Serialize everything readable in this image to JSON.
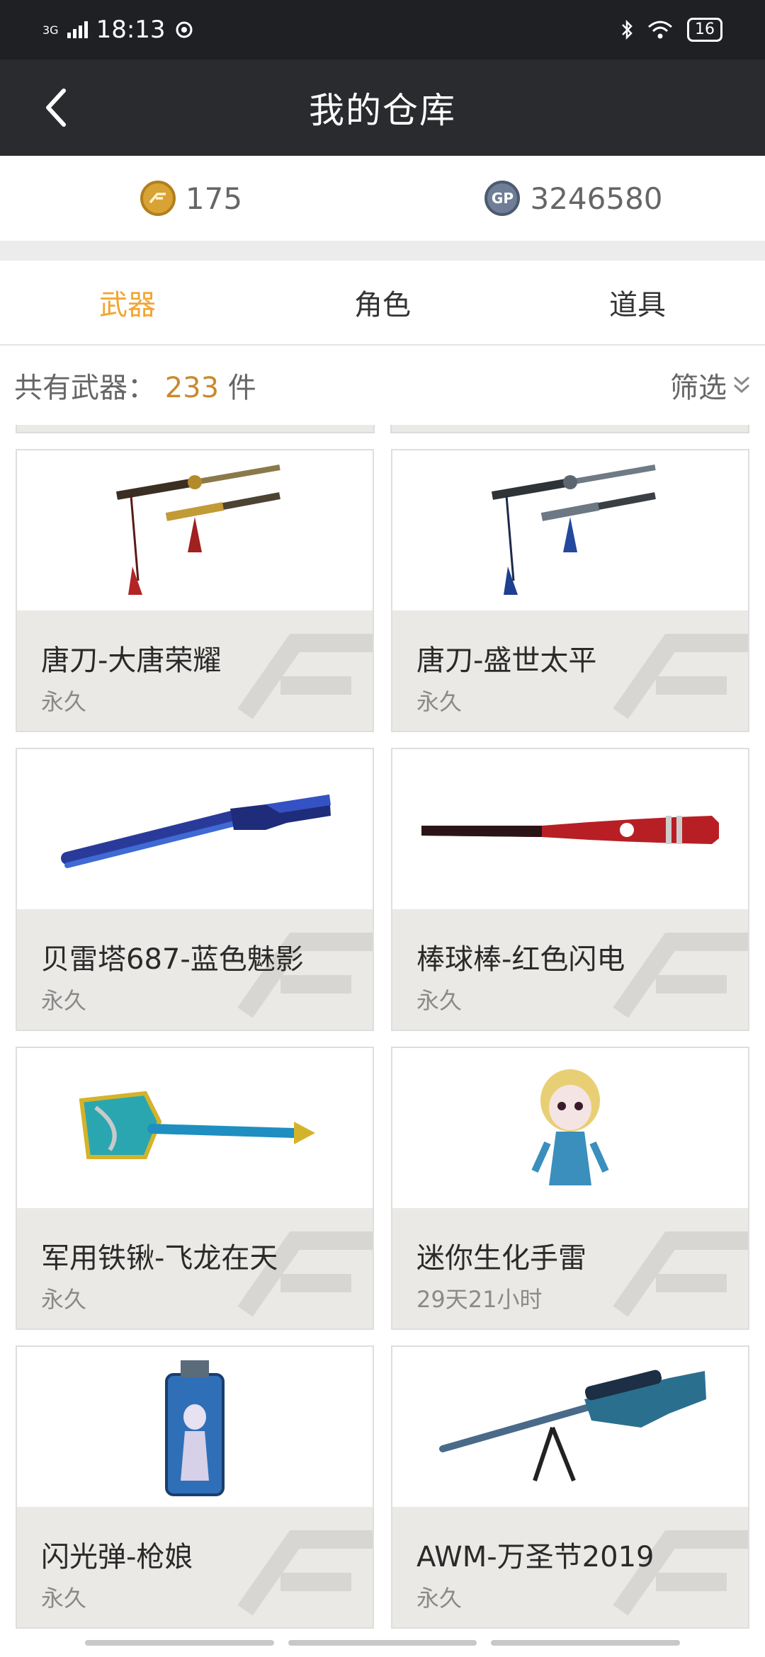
{
  "status_bar": {
    "time": "18:13",
    "network": "3G",
    "battery": "16"
  },
  "header": {
    "title": "我的仓库"
  },
  "currency": {
    "cf": {
      "icon": "cf-coin-icon",
      "value": "175"
    },
    "gp": {
      "icon": "gp-coin-icon",
      "label": "GP",
      "value": "3246580"
    }
  },
  "tabs": [
    {
      "label": "武器",
      "active": true
    },
    {
      "label": "角色",
      "active": false
    },
    {
      "label": "道具",
      "active": false
    }
  ],
  "summary": {
    "prefix": "共有武器：",
    "count": "233",
    "unit": "件",
    "filter_label": "筛选"
  },
  "items": [
    {
      "name": "唐刀-大唐荣耀",
      "duration": "永久",
      "image": "katana-gold-icon"
    },
    {
      "name": "唐刀-盛世太平",
      "duration": "永久",
      "image": "katana-blue-icon"
    },
    {
      "name": "贝雷塔687-蓝色魅影",
      "duration": "永久",
      "image": "shotgun-blue-icon"
    },
    {
      "name": "棒球棒-红色闪电",
      "duration": "永久",
      "image": "baseball-bat-icon"
    },
    {
      "name": "军用铁锹-飞龙在天",
      "duration": "永久",
      "image": "dragon-shovel-icon"
    },
    {
      "name": "迷你生化手雷",
      "duration": "29天21小时",
      "image": "mini-figure-icon"
    },
    {
      "name": "闪光弹-枪娘",
      "duration": "永久",
      "image": "flash-grenade-icon"
    },
    {
      "name": "AWM-万圣节2019",
      "duration": "永久",
      "image": "sniper-rifle-icon"
    }
  ],
  "colors": {
    "accent": "#f2a531",
    "count": "#c98a2e",
    "header_bg": "#2a2b2e",
    "card_info_bg": "#ebe9e6"
  }
}
